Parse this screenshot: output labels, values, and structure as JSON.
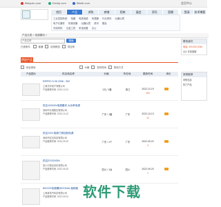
{
  "topbar": {
    "links": [
      "Bitepoin.com",
      "Etchip.com",
      "Bitefh.com"
    ],
    "right": "会员中心"
  },
  "nav": {
    "items": [
      "首页",
      "产品",
      "求购",
      "商铺",
      "招商",
      "展会",
      "资讯",
      "直播"
    ],
    "active_index": 1,
    "right_items": [
      "登录",
      "技术博客"
    ]
  },
  "subnav": {
    "row1": [
      "工业控制系统",
      "电器",
      "电线电缆",
      "传感器",
      "行业资讯",
      "仪器仪表"
    ],
    "row2": [
      "电子元器件",
      "机械设备",
      "仪器仪表",
      "资讯",
      "展会"
    ],
    "row3": [
      "光电材料",
      "五金工具",
      "机电设备",
      "办公"
    ]
  },
  "breadcrumb": "产品分类 > 电源模块 >",
  "search": {
    "placeholder": "产品名称",
    "button": "搜索"
  },
  "filter": {
    "label": "已选条件:",
    "options": [
      "普通",
      "检测报告",
      "供应商"
    ]
  },
  "section": {
    "tab": "供应产品"
  },
  "sort": {
    "label": "综合排序",
    "options": [
      "价格",
      "发布时间",
      "排序方式"
    ]
  },
  "table": {
    "headers": [
      "产品图片",
      "供应商名称",
      "价格",
      "所在地",
      "更新时间",
      "询价"
    ],
    "rows": [
      {
        "title": "REPRO 5 06 2008 - 300",
        "company": "上海艾科电子有限公司",
        "meta": "产品推荐时间: 2022-12-01",
        "price": "1元 / 1套",
        "location": "浙江",
        "date": "2022-12-19",
        "count": "154"
      },
      {
        "title": "供应10000W电源模块 大功率电源",
        "company": "深圳市长城数控有限公司",
        "meta": "产品推荐时间: 2022-10-12",
        "price": "广东 / 1套",
        "location": "广东",
        "date": "2022-10-13",
        "count": "12"
      },
      {
        "title": "供应220V电源门禁控制电源",
        "company": "深圳市宏达科技有限公司",
        "meta": "产品推荐时间: 2022-09-22",
        "price": "广东 / 1个",
        "location": "广东",
        "date": "2022-09-22",
        "count": "3"
      },
      {
        "title": "供应ZSJ024DN",
        "company": "四川中瑞自动化有限公司",
        "meta": "产品推荐时间: 2022-09-20",
        "price": "四川 / 1台",
        "location": "四川",
        "date": "2022-09-20",
        "count": "1"
      },
      {
        "title": "80V220电源模块ZX3046 高精度",
        "company": "上海某电气科技有限公司",
        "meta": "产品推荐时间: 2022-09-01",
        "price": "",
        "location": "",
        "date": "",
        "count": ""
      }
    ]
  },
  "sidebar": {
    "box1_title": "联系我们",
    "box1_lines": [
      "电话: 400-052-2066",
      "QQ: 在线客服"
    ],
    "box2_title": "采购推荐",
    "box2_lines": [
      "采购信息",
      "热门产品"
    ]
  },
  "watermark": "软件下载"
}
